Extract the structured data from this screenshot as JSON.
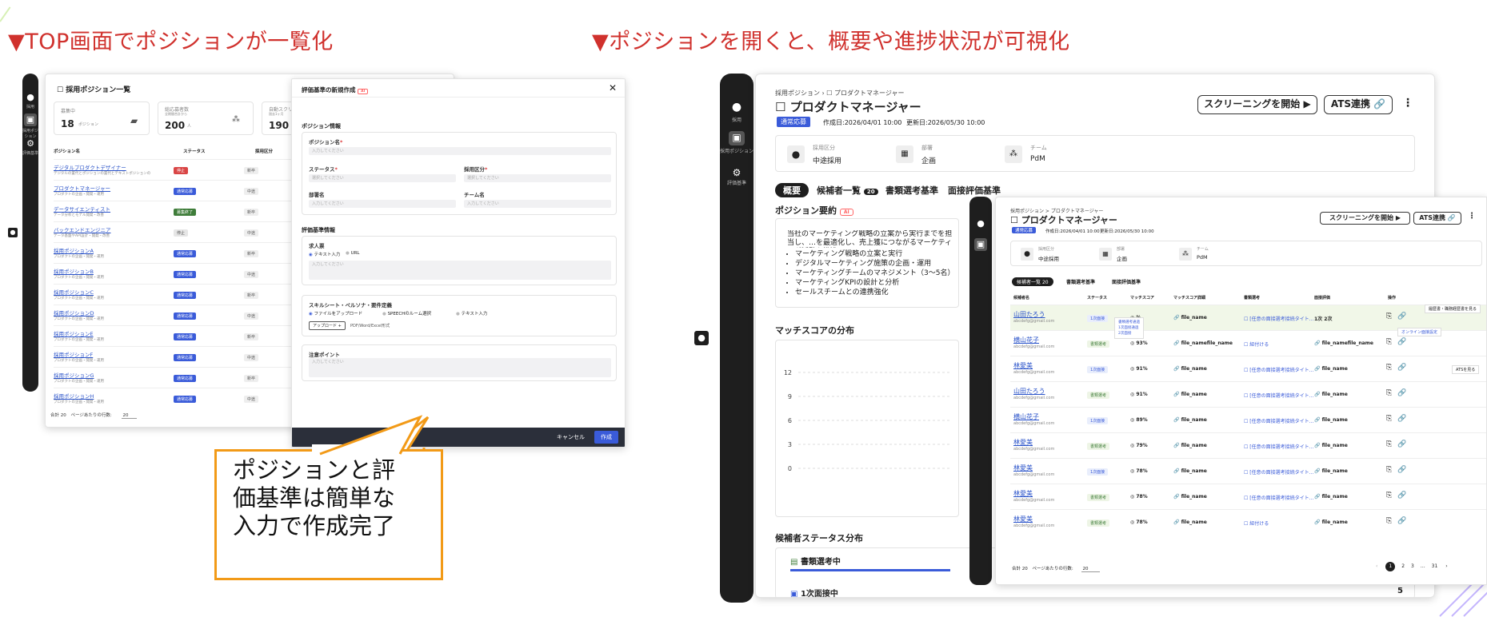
{
  "headings": {
    "left": "▼TOP画面でポジションが一覧化",
    "right": "▼ポジションを開くと、概要や進捗状況が可視化"
  },
  "callout": {
    "line1": "ポジションと評",
    "line2": "価基準は簡単な",
    "line3": "入力で作成完了"
  },
  "colors": {
    "accent_red": "#d0312d",
    "callout_border": "#f29a17",
    "link_blue": "#2952c9",
    "sidebar": "#1e1e1e"
  },
  "left_screen": {
    "page_title": "採用ポジション一覧",
    "sidebar_labels": [
      "採用",
      "採用ポジション",
      "評価基準"
    ],
    "stats": [
      {
        "label": "募集中",
        "value": "18",
        "unit": "ポジション"
      },
      {
        "label": "総応募者数",
        "sub": "全期間合計から",
        "value": "200",
        "unit": "人"
      },
      {
        "label": "自動スクリー…",
        "sub": "過去1ヶ月",
        "value": "190",
        "unit": "人"
      }
    ],
    "table": {
      "columns": [
        "ポジション名",
        "ステータス",
        "採用区分"
      ],
      "rows": [
        {
          "name": "デジタルプロダクトデザイナー",
          "desc": "デジタルの置代とポジションの置代とテキストポジションの",
          "status": "停止",
          "status_color": "#d94545",
          "type": "新卒"
        },
        {
          "name": "プロダクトマネージャー",
          "desc": "プロダクトの企画・開発・運用",
          "status": "通常応募",
          "status_color": "#3a5bd9",
          "type": "中途"
        },
        {
          "name": "データサイエンティスト",
          "desc": "データ分析とモデル開発・改善",
          "status": "募集終了",
          "status_color": "#3f7d3a",
          "type": "新卒"
        },
        {
          "name": "バックエンドエンジニア",
          "desc": "データ基盤やAPI設計・開発・改善",
          "status": "停止",
          "status_color": "#e6e6e6",
          "type": "中途"
        },
        {
          "name": "採用ポジションA",
          "desc": "プロダクトの企画・開発・運用",
          "status": "通常応募",
          "status_color": "#3a5bd9",
          "type": "新卒"
        },
        {
          "name": "採用ポジションB",
          "desc": "プロダクトの企画・開発・運用",
          "status": "通常応募",
          "status_color": "#3a5bd9",
          "type": "中途"
        },
        {
          "name": "採用ポジションC",
          "desc": "プロダクトの企画・開発・運用",
          "status": "通常応募",
          "status_color": "#3a5bd9",
          "type": "新卒"
        },
        {
          "name": "採用ポジションD",
          "desc": "プロダクトの企画・開発・運用",
          "status": "通常応募",
          "status_color": "#3a5bd9",
          "type": "中途"
        },
        {
          "name": "採用ポジションE",
          "desc": "プロダクトの企画・開発・運用",
          "status": "通常応募",
          "status_color": "#3a5bd9",
          "type": "新卒"
        },
        {
          "name": "採用ポジションF",
          "desc": "プロダクトの企画・開発・運用",
          "status": "通常応募",
          "status_color": "#3a5bd9",
          "type": "中途"
        },
        {
          "name": "採用ポジションG",
          "desc": "プロダクトの企画・開発・運用",
          "status": "通常応募",
          "status_color": "#3a5bd9",
          "type": "新卒"
        },
        {
          "name": "採用ポジションH",
          "desc": "プロダクトの企画・開発・運用",
          "status": "通常応募",
          "status_color": "#3a5bd9",
          "type": "中途"
        }
      ]
    },
    "footer": {
      "total": "合計 20",
      "per_page_label": "ページあたりの行数:",
      "per_page": "20"
    }
  },
  "modal": {
    "title": "評価基準の新規作成",
    "title_badge": "AI",
    "section_position": "ポジション情報",
    "position_name_label": "ポジション名",
    "position_name_placeholder": "入力してください",
    "status_label": "ステータス",
    "status_placeholder": "選択してください",
    "hire_type_label": "採用区分",
    "hire_type_placeholder": "選択してください",
    "dept_label": "部署名",
    "dept_placeholder": "入力してください",
    "team_label": "チーム名",
    "team_placeholder": "入力してください",
    "section_criteria": "評価基準情報",
    "job_label": "求人票",
    "job_option_text": "テキスト入力",
    "job_option_url": "URL",
    "job_placeholder": "入力してください",
    "skill_label": "スキルシート・ペルソナ・要件定義",
    "skill_option_file": "ファイルをアップロード",
    "skill_option_speech": "SPEECHのルーム選択",
    "skill_option_text": "テキスト入力",
    "upload_button": "アップロード",
    "upload_hint": "PDF/Word/Excel形式",
    "note_label": "注意ポイント",
    "note_placeholder": "入力してください",
    "cancel": "キャンセル",
    "create": "作成"
  },
  "right_screen": {
    "breadcrumb": "採用ポジション > プロダクトマネージャー",
    "breadcrumb_root": "採用ポジション",
    "breadcrumb_current": "プロダクトマネージャー",
    "title": "プロダクトマネージャー",
    "badge": "通常応募",
    "created": "作成日:2026/04/01 10:00",
    "updated": "更新日:2026/05/30 10:00",
    "btn_screening": "スクリーニングを開始 ▶",
    "btn_ats": "ATS連携",
    "info": [
      {
        "label": "採用区分",
        "value": "中途採用"
      },
      {
        "label": "部署",
        "value": "企画"
      },
      {
        "label": "チーム",
        "value": "PdM"
      }
    ],
    "tabs": [
      "概要",
      "候補者一覧",
      "書類選考基準",
      "面接評価基準"
    ],
    "candidate_count": "20",
    "summary_title": "ポジション要約",
    "summary_badge": "AI",
    "summary_text": "当社のマーケティング戦略の立案から実行までを担当し、…を最適化し、売上獲につながるマーケティング活動を推進",
    "summary_bullets": [
      "マーケティング戦略の立案と実行",
      "デジタルマーケティング施策の企画・運用",
      "マーケティングチームのマネジメント（3〜5名）",
      "マーケティングKPIの設計と分析",
      "セールスチームとの連携強化"
    ],
    "chart_title": "マッチスコアの分布",
    "status_title": "候補者ステータス分布",
    "status_rows": [
      {
        "label": "書類選考中",
        "count": ""
      },
      {
        "label": "1次面接中",
        "count": "5"
      }
    ],
    "sidebar_labels": [
      "採用",
      "採用ポジション",
      "評価基準"
    ]
  },
  "chart_data": {
    "type": "line",
    "title": "マッチスコアの分布",
    "yticks": [
      0,
      3,
      6,
      9,
      12
    ],
    "ylim": [
      0,
      12
    ]
  },
  "overlay": {
    "breadcrumb": "採用ポジション > プロダクトマネージャー",
    "title": "プロダクトマネージャー",
    "badge": "通常応募",
    "created": "作成日:2026/04/01 10:00",
    "updated": "更新日:2026/05/30 10:00",
    "btn_screening": "スクリーニングを開始 ▶",
    "btn_ats": "ATS連携",
    "info": [
      {
        "label": "採用区分",
        "value": "中途採用"
      },
      {
        "label": "部署",
        "value": "企画"
      },
      {
        "label": "チーム",
        "value": "PdM"
      }
    ],
    "tabs": [
      "候補者一覧",
      "書類選考基準",
      "面接評価基準"
    ],
    "tab_count": "20",
    "columns": [
      "候補者名",
      "ステータス",
      "マッチスコア",
      "マッチスコア詳細",
      "書類選考",
      "面接評価",
      "操作"
    ],
    "rows": [
      {
        "name": "山田たろう",
        "email": "abcdefg@gmail.com",
        "status": "1次面接",
        "score": "%",
        "file": "file_name",
        "doc": "[任意の面接選考接続タイト…",
        "eval": "1次",
        "eval2": "2次"
      },
      {
        "name": "横山花子",
        "email": "abcdefg@gmail.com",
        "status": "書類選考",
        "score": "93%",
        "file": "file_namefile_name",
        "doc": "紐付ける",
        "eval": "file_namefile_name",
        "eval2": ""
      },
      {
        "name": "林愛美",
        "email": "abcdefg@gmail.com",
        "status": "1次面接",
        "score": "91%",
        "file": "file_name",
        "doc": "[任意の面接選考接続タイト…",
        "eval": "file_name",
        "eval2": ""
      },
      {
        "name": "山田たろう",
        "email": "abcdefg@gmail.com",
        "status": "書類選考",
        "score": "91%",
        "file": "file_name",
        "doc": "[任意の面接選考接続タイト…",
        "eval": "file_name",
        "eval2": ""
      },
      {
        "name": "横山花子",
        "email": "abcdefg@gmail.com",
        "status": "1次面接",
        "score": "89%",
        "file": "file_name",
        "doc": "[任意の面接選考接続タイト…",
        "eval": "file_name",
        "eval2": ""
      },
      {
        "name": "林愛美",
        "email": "abcdefg@gmail.com",
        "status": "書類選考",
        "score": "79%",
        "file": "file_name",
        "doc": "[任意の面接選考接続タイト…",
        "eval": "file_name",
        "eval2": ""
      },
      {
        "name": "林愛美",
        "email": "abcdefg@gmail.com",
        "status": "1次面接",
        "score": "78%",
        "file": "file_name",
        "doc": "[任意の面接選考接続タイト…",
        "eval": "file_name",
        "eval2": ""
      },
      {
        "name": "林愛美",
        "email": "abcdefg@gmail.com",
        "status": "書類選考",
        "score": "78%",
        "file": "file_name",
        "doc": "[任意の面接選考接続タイト…",
        "eval": "file_name",
        "eval2": ""
      },
      {
        "name": "林愛美",
        "email": "abcdefg@gmail.com",
        "status": "書類選考",
        "score": "78%",
        "file": "file_name",
        "doc": "紐付ける",
        "eval": "file_name",
        "eval2": ""
      }
    ],
    "tooltip_status": [
      "書類選考通過",
      "1次面接通過",
      "2次面接"
    ],
    "tooltip_online": "オンライン面接設定",
    "tooltip_hist": "履歴書・職務経歴書を見る",
    "tooltip_ats": "ATSを見る",
    "footer_total": "合計 20",
    "footer_per_page_label": "ページあたりの行数:",
    "footer_per_page": "20",
    "pages": [
      "1",
      "2",
      "3",
      "…",
      "31"
    ]
  }
}
